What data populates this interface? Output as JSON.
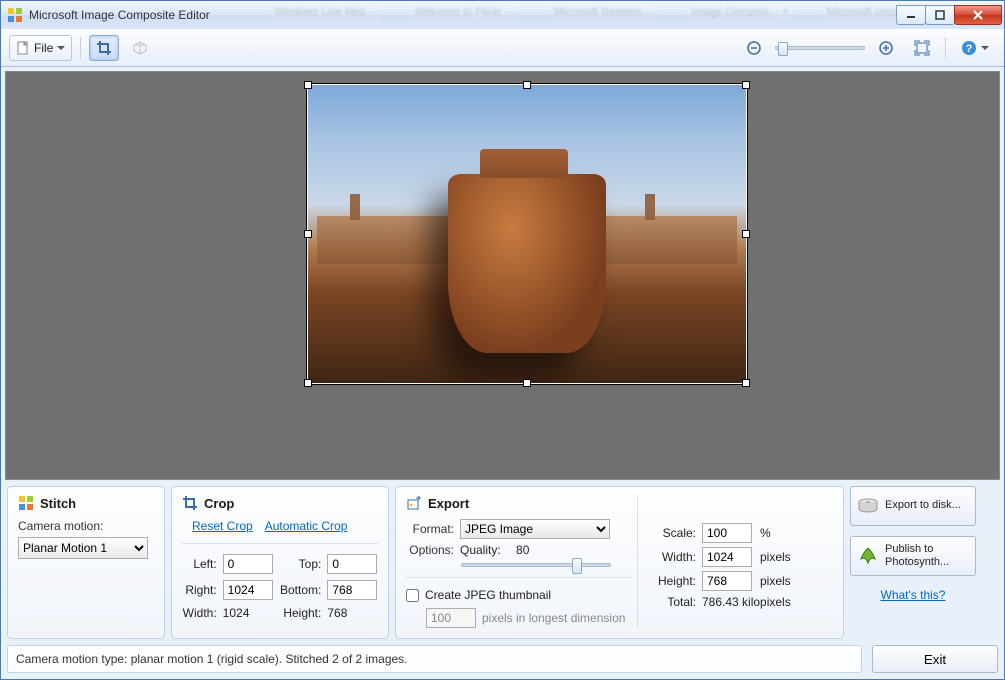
{
  "window": {
    "title": "Microsoft Image Composite Editor"
  },
  "toolbar": {
    "file_label": "File"
  },
  "stitch": {
    "heading": "Stitch",
    "camera_motion_label": "Camera motion:",
    "camera_motion_value": "Planar Motion 1"
  },
  "crop": {
    "heading": "Crop",
    "reset_link": "Reset Crop",
    "auto_link": "Automatic Crop",
    "left_label": "Left:",
    "left_value": "0",
    "top_label": "Top:",
    "top_value": "0",
    "right_label": "Right:",
    "right_value": "1024",
    "bottom_label": "Bottom:",
    "bottom_value": "768",
    "width_label": "Width:",
    "width_value": "1024",
    "height_label": "Height:",
    "height_value": "768"
  },
  "export": {
    "heading": "Export",
    "format_label": "Format:",
    "format_value": "JPEG Image",
    "options_label": "Options:",
    "quality_label": "Quality:",
    "quality_value": "80",
    "create_thumb_label": "Create JPEG thumbnail",
    "thumb_pixels_value": "100",
    "thumb_pixels_suffix": "pixels in longest dimension",
    "scale_label": "Scale:",
    "scale_value": "100",
    "scale_unit": "%",
    "width_label": "Width:",
    "width_value": "1024",
    "px_unit": "pixels",
    "height_label": "Height:",
    "height_value": "768",
    "total_label": "Total:",
    "total_value": "786.43 kilopixels"
  },
  "actions": {
    "export_disk": "Export to disk...",
    "publish_photosynth": "Publish to Photosynth...",
    "whats_this": "What's this?",
    "exit": "Exit"
  },
  "status": {
    "text": "Camera motion type: planar motion 1 (rigid scale). Stitched 2 of 2 images."
  }
}
